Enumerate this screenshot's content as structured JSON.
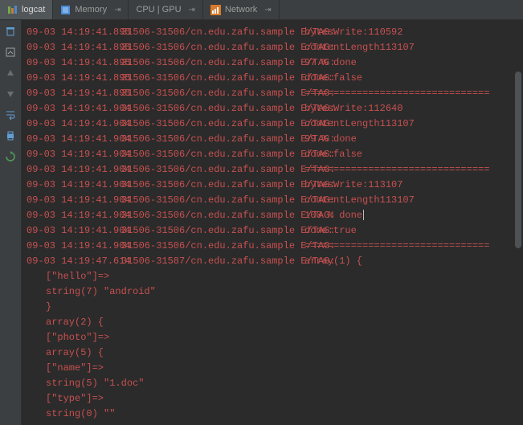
{
  "tabs": [
    {
      "label": "logcat",
      "icon": "logcat-icon",
      "active": true,
      "pin": false
    },
    {
      "label": "Memory",
      "icon": "memory-icon",
      "active": false,
      "pin": true
    },
    {
      "label": "CPU | GPU",
      "icon": "",
      "active": false,
      "pin": true
    },
    {
      "label": "Network",
      "icon": "network-icon",
      "active": false,
      "pin": true
    }
  ],
  "gutter": [
    {
      "name": "trash-icon",
      "glyph": "trash"
    },
    {
      "name": "scroll-end-icon",
      "glyph": "scroll"
    },
    {
      "name": "up-arrow-icon",
      "glyph": "up"
    },
    {
      "name": "down-arrow-icon",
      "glyph": "down"
    },
    {
      "name": "wrap-icon",
      "glyph": "wrap"
    },
    {
      "name": "print-icon",
      "glyph": "print"
    },
    {
      "name": "restart-icon",
      "glyph": "restart"
    }
  ],
  "prefix": {
    "pid_a": "31506-31506/cn.edu.zafu.sample E/TAG:",
    "pid_b": "31506-31587/cn.edu.zafu.sample E/TAG:"
  },
  "log": [
    {
      "ts": "09-03 14:19:41.895",
      "p": "a",
      "msg": "bytesWrite:110592"
    },
    {
      "ts": "09-03 14:19:41.895",
      "p": "a",
      "msg": "contentLength113107"
    },
    {
      "ts": "09-03 14:19:41.895",
      "p": "a",
      "msg": "97 % done"
    },
    {
      "ts": "09-03 14:19:41.895",
      "p": "a",
      "msg": "done:false"
    },
    {
      "ts": "09-03 14:19:41.895",
      "p": "a",
      "msg": "================================"
    },
    {
      "ts": "09-03 14:19:41.904",
      "p": "a",
      "msg": "bytesWrite:112640"
    },
    {
      "ts": "09-03 14:19:41.904",
      "p": "a",
      "msg": "contentLength113107"
    },
    {
      "ts": "09-03 14:19:41.904",
      "p": "a",
      "msg": "99 % done"
    },
    {
      "ts": "09-03 14:19:41.904",
      "p": "a",
      "msg": "done:false"
    },
    {
      "ts": "09-03 14:19:41.904",
      "p": "a",
      "msg": "================================"
    },
    {
      "ts": "09-03 14:19:41.904",
      "p": "a",
      "msg": "bytesWrite:113107"
    },
    {
      "ts": "09-03 14:19:41.904",
      "p": "a",
      "msg": "contentLength113107"
    },
    {
      "ts": "09-03 14:19:41.904",
      "p": "a",
      "msg": "100 % done",
      "cursor": true
    },
    {
      "ts": "09-03 14:19:41.904",
      "p": "a",
      "msg": "done:true"
    },
    {
      "ts": "09-03 14:19:41.904",
      "p": "a",
      "msg": "================================"
    },
    {
      "ts": "09-03 14:19:47.614",
      "p": "b",
      "msg": "array(1) {"
    }
  ],
  "dump": [
    "[\"hello\"]=>",
    "string(7) \"android\"",
    "}",
    "array(2) {",
    "[\"photo\"]=>",
    "array(5) {",
    "[\"name\"]=>",
    "string(5) \"1.doc\"",
    "[\"type\"]=>",
    "string(0) \"\""
  ],
  "pin_glyph": "⇥"
}
